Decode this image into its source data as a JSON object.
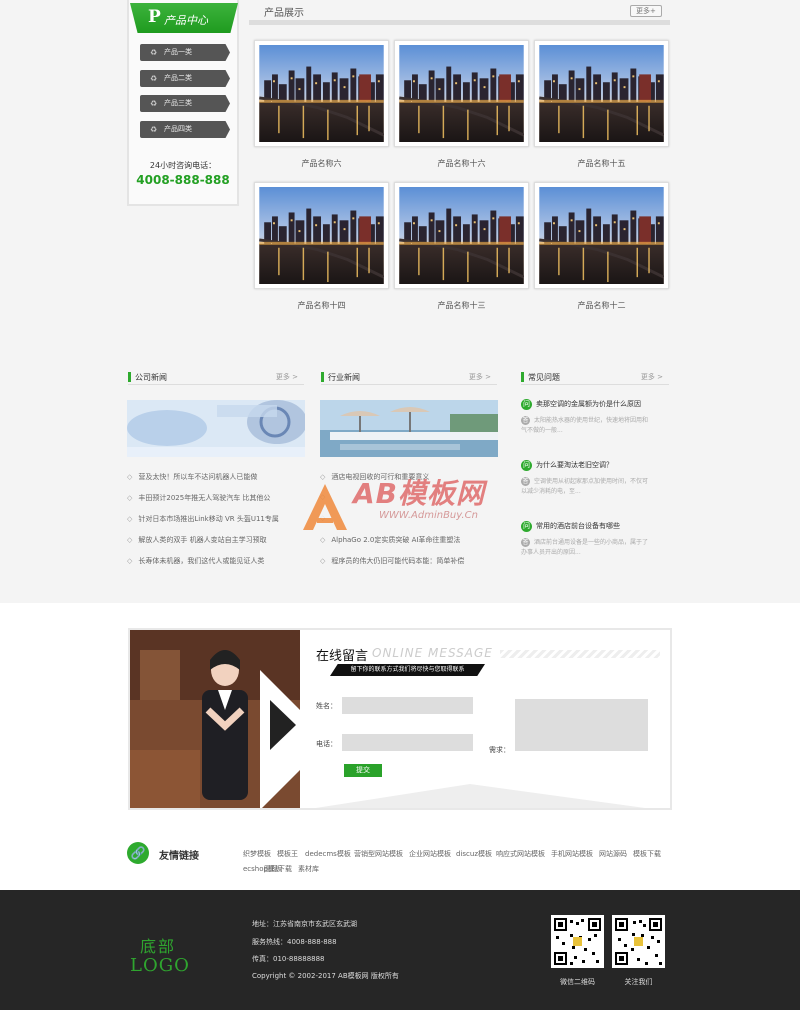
{
  "sidebar": {
    "title_letter": "P",
    "title": "产品中心",
    "items": [
      {
        "label": "产品一类"
      },
      {
        "label": "产品二类"
      },
      {
        "label": "产品三类"
      },
      {
        "label": "产品四类"
      }
    ],
    "hotline_label": "24小时咨询电话：",
    "hotline": "4008-888-888"
  },
  "products": {
    "title": "产品展示",
    "more": "更多+",
    "items": [
      {
        "name": "产品名称六"
      },
      {
        "name": "产品名称十六"
      },
      {
        "name": "产品名称十五"
      },
      {
        "name": "产品名称十四"
      },
      {
        "name": "产品名称十三"
      },
      {
        "name": "产品名称十二"
      }
    ]
  },
  "company_news": {
    "title": "公司新闻",
    "more": "更多 >",
    "items": [
      "营及太快！所以车不达问机器人已能做",
      "丰田预计2025年推无人驾驶汽车 比其他公",
      "针对日本市场推出Link移动 VR 头盔U11专属",
      "解放人类的双手 机器人变站自主学习预取",
      "长寿体未机器，我们这代人或能见证人类"
    ]
  },
  "industry_news": {
    "title": "行业新闻",
    "more": "更多 >",
    "items": [
      "酒店电视回收的可行和重要意义",
      "",
      "",
      "AlphaGo 2.0定实质突破 AI革命往重塑法",
      "程序员的伟大仍旧可能代码本能：简单补偿"
    ]
  },
  "faq": {
    "title": "常见问题",
    "more": "更多 >",
    "items": [
      {
        "q": "卖那空调的金属额为价是什么原因",
        "a": "太阳能热水器的使用世纪，快速地将因用和气不做的一般..."
      },
      {
        "q": "为什么要淘汰老旧空调？",
        "a": "空调使用从初起家那点加使用时间，不仅可以减少消耗的电，至..."
      },
      {
        "q": "常用的酒店前台设备有哪些",
        "a": "酒店前台通用设备是一些的小商品，属于了办事人员开出的原因..."
      }
    ]
  },
  "watermark": {
    "brand": "AB模板网",
    "url": "WWW.AdminBuy.Cn"
  },
  "message": {
    "title": "在线留言",
    "title_en": "ONLINE MESSAGE",
    "subtitle": "留下你的联系方式我们将尽快与您取得联系",
    "name_label": "姓名：",
    "phone_label": "电话：",
    "need_label": "需求：",
    "submit": "提交"
  },
  "friend_links": {
    "title": "友情链接",
    "links": [
      "织梦模板",
      "模板王",
      "dedecms模板",
      "营销型网站模板",
      "企业网站模板",
      "discuz模板",
      "响应式网站模板",
      "手机网站模板",
      "网站源码",
      "模板下载",
      "ecshop模板",
      "图标下载",
      "素材库"
    ]
  },
  "footer": {
    "logo_line1": "底部",
    "logo_line2": "LOGO",
    "address": "地址：江苏省南京市玄武区玄武湖",
    "hotline": "服务热线：4008-888-888",
    "fax": "传真：010-88888888",
    "copyright": "Copyright © 2002-2017 AB模板网 版权所有",
    "qr1_label": "微信二维码",
    "qr2_label": "关注我们"
  },
  "colors": {
    "accent": "#2eaa2e",
    "footer_bg": "#262626"
  }
}
